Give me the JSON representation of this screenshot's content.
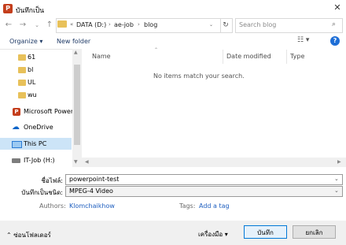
{
  "window": {
    "title": "บันทึกเป็น",
    "app_icon_letter": "P"
  },
  "nav": {
    "back_icon": "arrow-left-icon",
    "forward_icon": "arrow-right-icon",
    "recent_icon": "chevron-down-icon",
    "up_icon": "arrow-up-icon"
  },
  "address": {
    "overflow": "«",
    "segments": [
      "DATA (D:)",
      "ae-job",
      "blog"
    ],
    "separator": "›"
  },
  "search": {
    "placeholder": "Search blog"
  },
  "toolbar": {
    "organize_label": "Organize ▾",
    "new_folder_label": "New folder",
    "help": "?"
  },
  "sidebar": {
    "items": [
      {
        "label": "61",
        "icon": "folder-icon"
      },
      {
        "label": "bl",
        "icon": "folder-icon"
      },
      {
        "label": "UL",
        "icon": "folder-icon"
      },
      {
        "label": "wu",
        "icon": "folder-icon"
      },
      {
        "label": "Microsoft PowerP",
        "icon": "powerpoint-icon"
      },
      {
        "label": "OneDrive",
        "icon": "cloud-icon"
      },
      {
        "label": "This PC",
        "icon": "computer-icon",
        "selected": true
      },
      {
        "label": "IT-Job (H:)",
        "icon": "network-drive-icon"
      }
    ]
  },
  "file_list": {
    "columns": [
      "Name",
      "Date modified",
      "Type"
    ],
    "empty_message": "No items match your search."
  },
  "form": {
    "filename_label": "ชื่อไฟล์:",
    "filename_value": "powerpoint-test",
    "filetype_label": "บันทึกเป็นชนิด:",
    "filetype_value": "MPEG-4 Video",
    "authors_label": "Authors:",
    "authors_value": "Klomchaikhow",
    "tags_label": "Tags:",
    "tags_value": "Add a tag"
  },
  "footer": {
    "hide_folders_label": "ซ่อนโฟลเดอร์",
    "tools_label": "เครื่องมือ",
    "save_label": "บันทึก",
    "cancel_label": "ยกเลิก"
  },
  "colors": {
    "accent": "#0078d7",
    "selection": "#cce4f7",
    "link": "#1f5fbf",
    "folder": "#e8c15a"
  }
}
